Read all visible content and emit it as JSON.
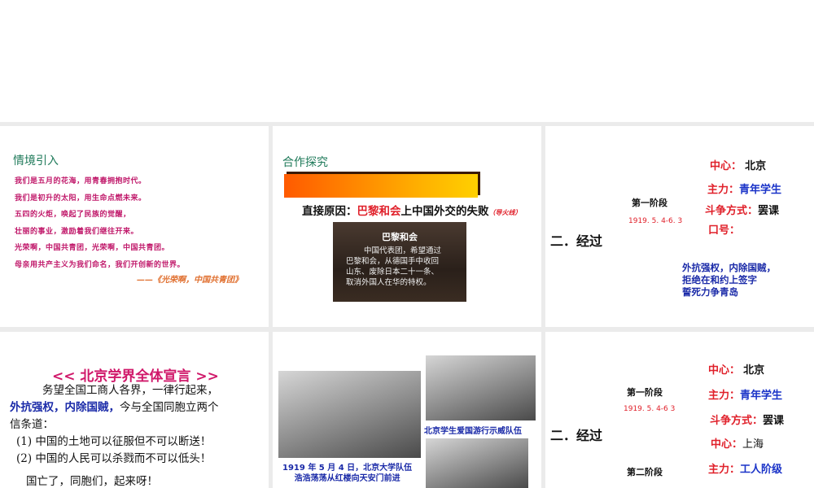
{
  "slide1": {
    "heading": "情境引入",
    "poem": [
      "我们是五月的花海，用青春拥抱时代。",
      "我们是初升的太阳，用生命点燃未来。",
      "五四的火炬，唤起了民族的觉醒，",
      "壮丽的事业，激励着我们继往开来。",
      "光荣啊，中国共青团，光荣啊，中国共青团。",
      "母亲用共产主义为我们命名，我们开创新的世界。"
    ],
    "source": "——《光荣啊，中国共青团》"
  },
  "slide2": {
    "heading": "合作探究",
    "cause_label": "直接原因：",
    "cause_highlight": "巴黎和会",
    "cause_rest": "上中国外交的失败",
    "note": "（导火线）",
    "image_title": "巴黎和会",
    "image_text": [
      "中国代表团，希望通过",
      "巴黎和会，从德国手中收回",
      "山东、废除日本二十一条、",
      "取消外国人在华的特权。"
    ]
  },
  "slide3": {
    "section": "二．经过",
    "stage": "第一阶段",
    "date": "1919. 5. 4-6. 3",
    "center_label": "中心：",
    "center": "北京",
    "force_label": "主力：",
    "force": "青年学生",
    "method_label": "斗争方式：",
    "method": "罢课",
    "slogan_label": "口号：",
    "slogans": [
      "外抗强权，内除国贼，",
      "拒绝在和约上签字",
      "誓死力争青岛"
    ]
  },
  "slide4": {
    "title": "<< 北京学界全体宣言 >>",
    "line1": "务望全国工商人各界，一律行起来，",
    "line2_blue": "外抗强权，内除国贼，",
    "line2_rest": "今与全国同胞立两个",
    "line3": "信条道：",
    "item1": "(1) 中国的土地可以征服但不可以断送！",
    "item2": "(2) 中国的人民可以杀戮而不可以低头！",
    "closing": "国亡了，同胞们，起来呀！"
  },
  "slide5": {
    "caption_main": [
      "1919 年 5 月 4 日，北京大学队伍",
      "浩浩荡荡从红楼向天安门前进"
    ],
    "caption_right": "北京学生爱国游行示威队伍"
  },
  "slide6": {
    "section": "二．经过",
    "stage1": "第一阶段",
    "date1": "1919. 5. 4-6 3",
    "center_label": "中心：",
    "center1": "北京",
    "force_label": "主力：",
    "force1": "青年学生",
    "method_label": "斗争方式：",
    "method1": "罢课",
    "center2": "上海",
    "force2": "工人阶级",
    "stage2": "第二阶段"
  }
}
